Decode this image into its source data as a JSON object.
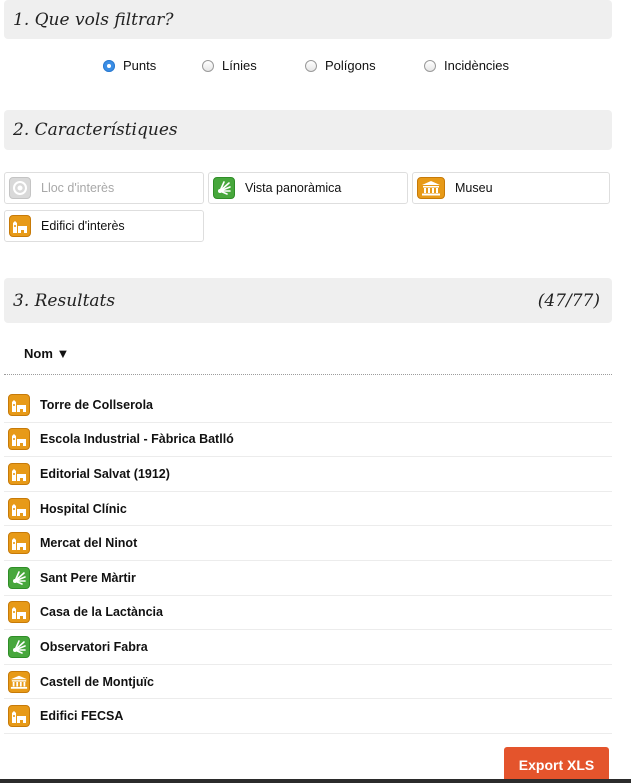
{
  "filter": {
    "title": "1. Que vols filtrar?",
    "options": [
      {
        "label": "Punts",
        "checked": true
      },
      {
        "label": "Línies",
        "checked": false
      },
      {
        "label": "Polígons",
        "checked": false
      },
      {
        "label": "Incidències",
        "checked": false
      }
    ]
  },
  "characteristics": {
    "title": "2. Característiques",
    "chips": [
      {
        "label": "Lloc d'interès",
        "icon": "lloc-icon",
        "enabled": false
      },
      {
        "label": "Vista panoràmica",
        "icon": "vista-panoramica-icon",
        "enabled": true
      },
      {
        "label": "Museu",
        "icon": "museu-icon",
        "enabled": true
      },
      {
        "label": "Edifici d'interès",
        "icon": "edifici-icon",
        "enabled": true
      }
    ]
  },
  "results": {
    "title": "3. Resultats",
    "count": "(47/77)",
    "column_header": "Nom ▼",
    "rows": [
      {
        "name": "Torre de Collserola",
        "icon": "edifici-icon"
      },
      {
        "name": "Escola Industrial - Fàbrica Batlló",
        "icon": "edifici-icon"
      },
      {
        "name": "Editorial Salvat (1912)",
        "icon": "edifici-icon"
      },
      {
        "name": "Hospital Clínic",
        "icon": "edifici-icon"
      },
      {
        "name": "Mercat del Ninot",
        "icon": "edifici-icon"
      },
      {
        "name": "Sant Pere Màrtir",
        "icon": "vista-panoramica-icon"
      },
      {
        "name": "Casa de la Lactància",
        "icon": "edifici-icon"
      },
      {
        "name": "Observatori Fabra",
        "icon": "vista-panoramica-icon"
      },
      {
        "name": "Castell de Montjuïc",
        "icon": "museu-icon"
      },
      {
        "name": "Edifici FECSA",
        "icon": "edifici-icon"
      }
    ]
  },
  "export": {
    "label": "Export XLS"
  },
  "colors": {
    "header_bg": "#efefef",
    "radio_accent": "#3a8ee6",
    "edifici": "#e79a18",
    "vista": "#47a73c",
    "export_button": "#e4542c"
  }
}
